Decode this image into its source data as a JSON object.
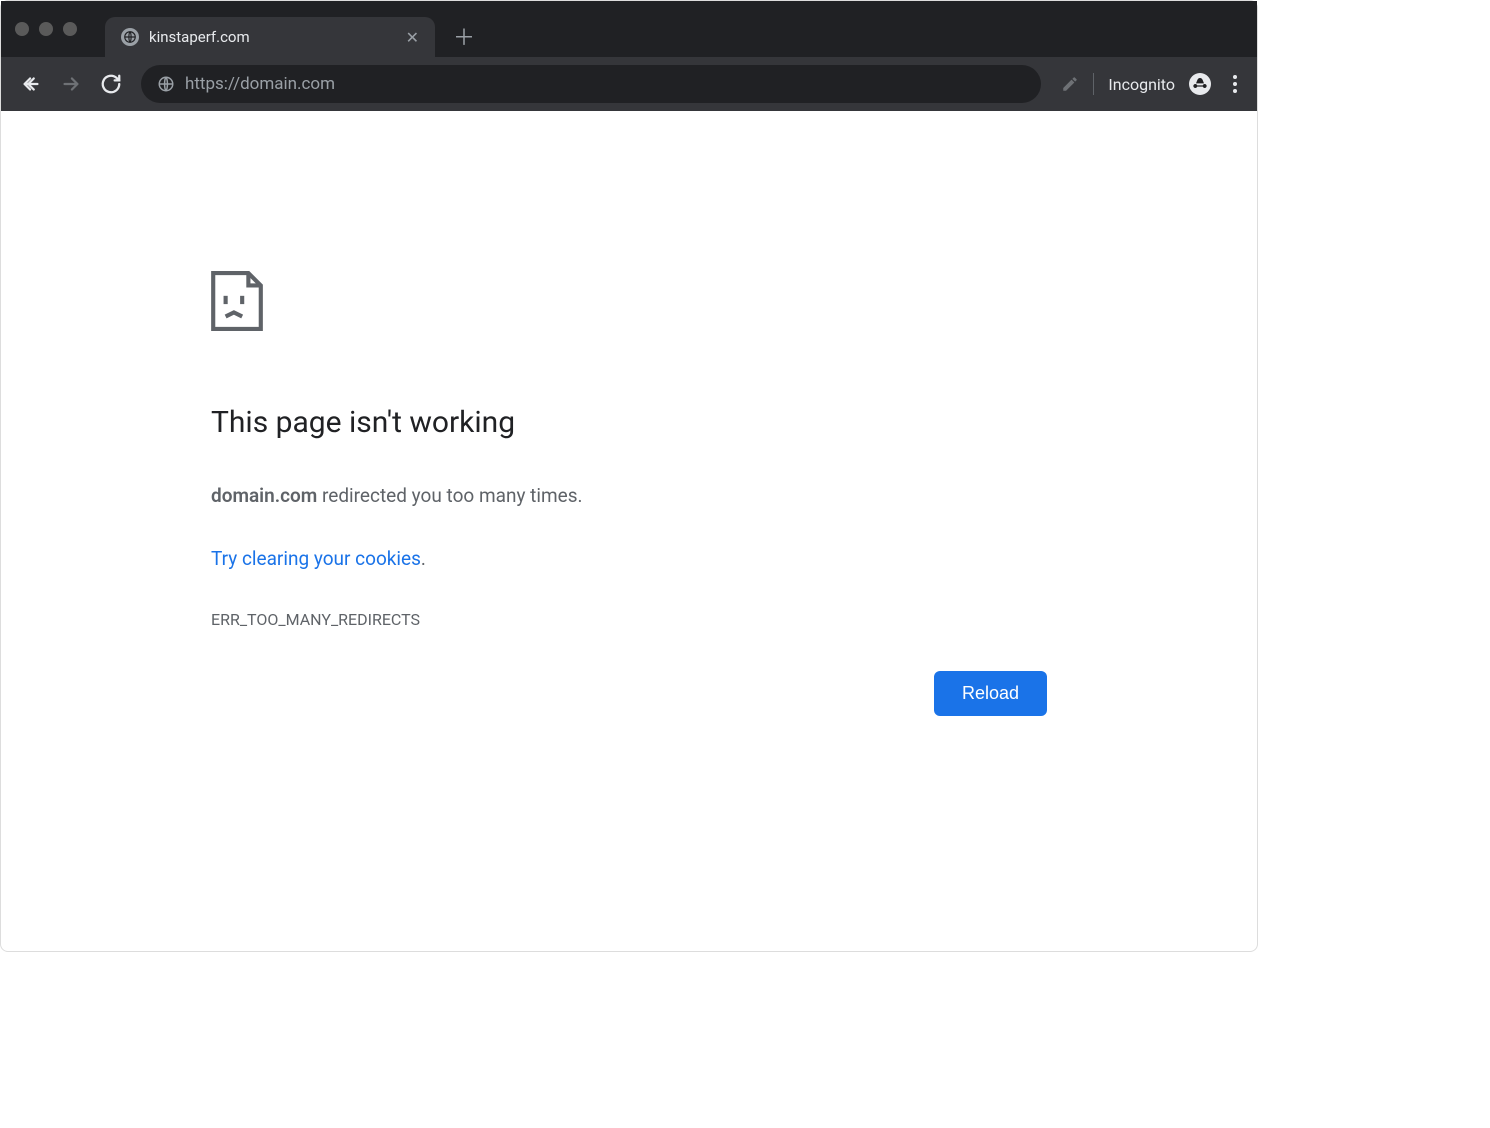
{
  "tab": {
    "title": "kinstaperf.com"
  },
  "toolbar": {
    "url": "https://domain.com",
    "incognito_label": "Incognito"
  },
  "error": {
    "title": "This page isn't working",
    "domain": "domain.com",
    "desc_suffix": " redirected you too many times.",
    "link_text": "Try clearing your cookies",
    "link_suffix": ".",
    "code": "ERR_TOO_MANY_REDIRECTS",
    "reload_label": "Reload"
  }
}
